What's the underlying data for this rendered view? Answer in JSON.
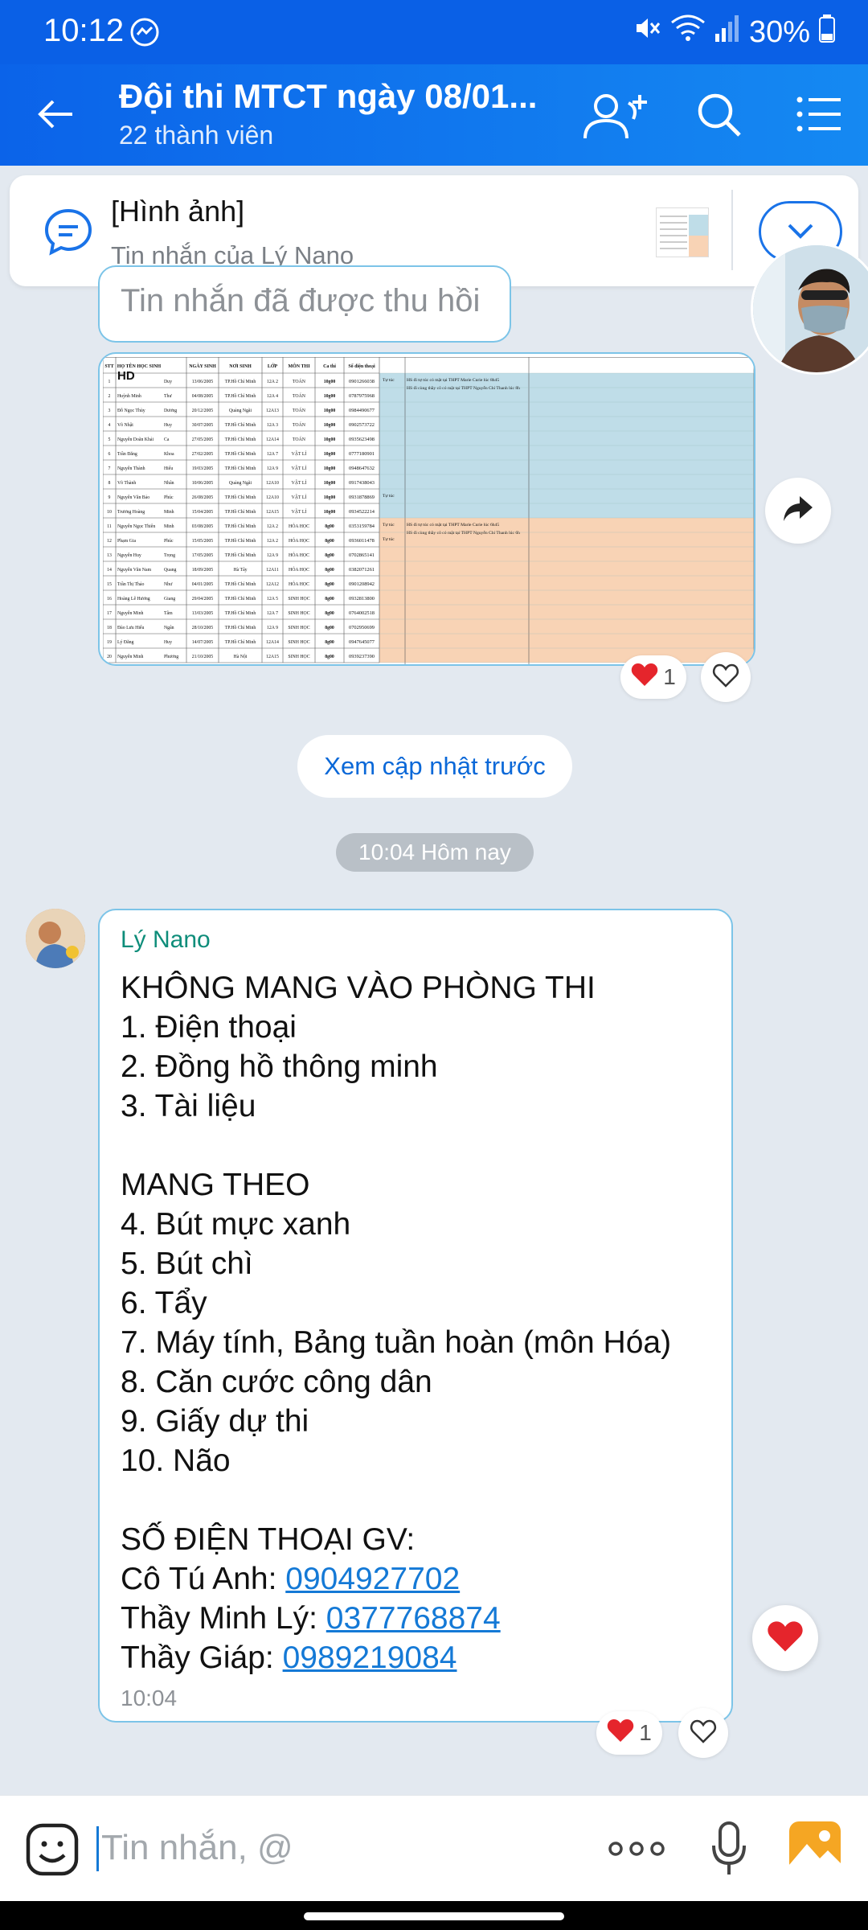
{
  "status_bar": {
    "time": "10:12",
    "battery": "30%"
  },
  "header": {
    "title": "Đội thi MTCT ngày 08/01...",
    "subtitle": "22 thành viên",
    "icons": [
      "back-arrow-icon",
      "add-member-icon",
      "search-icon",
      "menu-list-icon"
    ]
  },
  "pinned": {
    "title": "[Hình ảnh]",
    "subtitle": "Tin nhắn của Lý Nano"
  },
  "messages": {
    "recalled_text": "Tin nhắn đã được thu hồi",
    "image_reaction": {
      "count": "1"
    },
    "older_button": "Xem cập nhật trước",
    "time_divider": "10:04 Hôm nay",
    "text_message": {
      "sender": "Lý Nano",
      "lines": [
        "KHÔNG MANG VÀO PHÒNG THI",
        "1. Điện thoại",
        "2. Đồng hồ thông minh",
        "3. Tài liệu",
        "",
        "MANG THEO",
        "4. Bút mực xanh",
        "5. Bút chì",
        "6. Tẩy",
        "7. Máy tính, Bảng tuần hoàn (môn Hóa)",
        "8. Căn cước công dân",
        "9. Giấy dự thi",
        "10. Não",
        "",
        "SỐ ĐIỆN THOẠI GV:"
      ],
      "contacts": [
        {
          "label": "Cô Tú Anh: ",
          "phone": "0904927702"
        },
        {
          "label": "Thầy Minh Lý: ",
          "phone": "0377768874"
        },
        {
          "label": "Thầy Giáp: ",
          "phone": "0989219084"
        }
      ],
      "time": "10:04",
      "reaction_count": "1"
    }
  },
  "spreadsheet": {
    "badge": "HD",
    "headers": [
      "STT",
      "HỌ TÊN HỌC SINH",
      "",
      "NGÀY SINH",
      "NƠI SINH",
      "LỚP",
      "MÔN THI",
      "Ca thi",
      "Số điện thoại"
    ],
    "rows": [
      [
        "1",
        "",
        "Duy",
        "13/06/2005",
        "TP.Hồ Chí Minh",
        "12A 2",
        "TOÁN",
        "10g00",
        "0901266038"
      ],
      [
        "2",
        "Huỳnh Minh",
        "Thư",
        "04/08/2005",
        "TP.Hồ Chí Minh",
        "12A 4",
        "TOÁN",
        "10g00",
        "0787975968"
      ],
      [
        "3",
        "Đỗ Ngọc Thùy",
        "Dương",
        "20/12/2005",
        "Quảng Ngãi",
        "12A13",
        "TOÁN",
        "10g00",
        "0984490677"
      ],
      [
        "4",
        "Võ Nhật",
        "Huy",
        "30/07/2005",
        "TP.Hồ Chí Minh",
        "12A 3",
        "TOÁN",
        "10g00",
        "0902573722"
      ],
      [
        "5",
        "Nguyễn Doãn Khải",
        "Ca",
        "27/05/2005",
        "TP.Hồ Chí Minh",
        "12A14",
        "TOÁN",
        "10g00",
        "0935623498"
      ],
      [
        "6",
        "Trần Đăng",
        "Khoa",
        "27/02/2005",
        "TP.Hồ Chí Minh",
        "12A 7",
        "VẬT LÍ",
        "10g00",
        "0777180901"
      ],
      [
        "7",
        "Nguyễn Thành",
        "Hiếu",
        "19/03/2005",
        "TP.Hồ Chí Minh",
        "12A 9",
        "VẬT LÍ",
        "10g00",
        "0948647632"
      ],
      [
        "8",
        "Võ Thành",
        "Nhân",
        "10/06/2005",
        "Quảng Ngãi",
        "12A10",
        "VẬT LÍ",
        "10g00",
        "0917438043"
      ],
      [
        "9",
        "Nguyễn Văn Bảo",
        "Phúc",
        "26/08/2005",
        "TP.Hồ Chí Minh",
        "12A10",
        "VẬT LÍ",
        "10g00",
        "0931878869"
      ],
      [
        "10",
        "Trương Hoàng",
        "Minh",
        "15/04/2005",
        "TP.Hồ Chí Minh",
        "12A15",
        "VẬT LÍ",
        "10g00",
        "0934522214"
      ],
      [
        "11",
        "Nguyễn Ngọc Thiên",
        "Minh",
        "03/08/2005",
        "TP.Hồ Chí Minh",
        "12A 2",
        "HÓA HỌC",
        "8g00",
        "0353159784"
      ],
      [
        "12",
        "Phạm Gia",
        "Phúc",
        "15/05/2005",
        "TP.Hồ Chí Minh",
        "12A 2",
        "HÓA HỌC",
        "8g00",
        "0936011478"
      ],
      [
        "13",
        "Nguyễn Huy",
        "Trọng",
        "17/05/2005",
        "TP.Hồ Chí Minh",
        "12A 9",
        "HÓA HỌC",
        "8g00",
        "0702865141"
      ],
      [
        "14",
        "Nguyễn Văn Nam",
        "Quang",
        "18/09/2005",
        "Hà Tây",
        "12A11",
        "HÓA HỌC",
        "8g00",
        "0382071261"
      ],
      [
        "15",
        "Trần Thị Thảo",
        "Như",
        "04/01/2005",
        "TP.Hồ Chí Minh",
        "12A12",
        "HÓA HỌC",
        "8g00",
        "0901208942"
      ],
      [
        "16",
        "Hoàng Lê Hương",
        "Giang",
        "29/04/2005",
        "TP.Hồ Chí Minh",
        "12A 5",
        "SINH HỌC",
        "8g00",
        "0932813800"
      ],
      [
        "17",
        "Nguyễn Minh",
        "Tâm",
        "13/03/2005",
        "TP.Hồ Chí Minh",
        "12A 7",
        "SINH HỌC",
        "8g00",
        "0764002518"
      ],
      [
        "18",
        "Đào Lưu Hiếu",
        "Ngân",
        "28/10/2005",
        "TP.Hồ Chí Minh",
        "12A 9",
        "SINH HỌC",
        "8g00",
        "0702950699"
      ],
      [
        "19",
        "Lý Đăng",
        "Huy",
        "14/07/2005",
        "TP.Hồ Chí Minh",
        "12A14",
        "SINH HỌC",
        "8g00",
        "0947645077"
      ],
      [
        "20",
        "Nguyễn Minh",
        "Phương",
        "21/10/2005",
        "Hà Nội",
        "12A15",
        "SINH HỌC",
        "8g00",
        "0939237390"
      ]
    ],
    "notes": [
      {
        "row": 0,
        "col1": "Tự túc",
        "col2": "HS đi tự túc có mặt tại THPT Marie Curie lúc 8h45"
      },
      {
        "row": 1,
        "col1": "",
        "col2": "HS đi cùng thầy cô có mặt tại THPT Nguyễn Chí Thanh lúc 8h"
      },
      {
        "row": 8,
        "col1": "Tự túc",
        "col2": ""
      },
      {
        "row": 10,
        "col1": "Tự túc",
        "col2": "HS đi tự túc có mặt tại THPT Marie Curie lúc 6h45"
      },
      {
        "row": 11,
        "col1": "Tự túc",
        "col2": "HS đi cùng thầy cô có mặt tại THPT Nguyễn Chí Thanh lúc 6h"
      }
    ],
    "colors": {
      "physics_math": "#BFDDE8",
      "chem_bio": "#F8D3B5"
    }
  },
  "input": {
    "placeholder": "Tin nhắn, @"
  },
  "colors": {
    "accent": "#0A60E6",
    "bubble_border": "#7CC4E8",
    "link": "#1479D6",
    "sender": "#0E8D7A"
  }
}
